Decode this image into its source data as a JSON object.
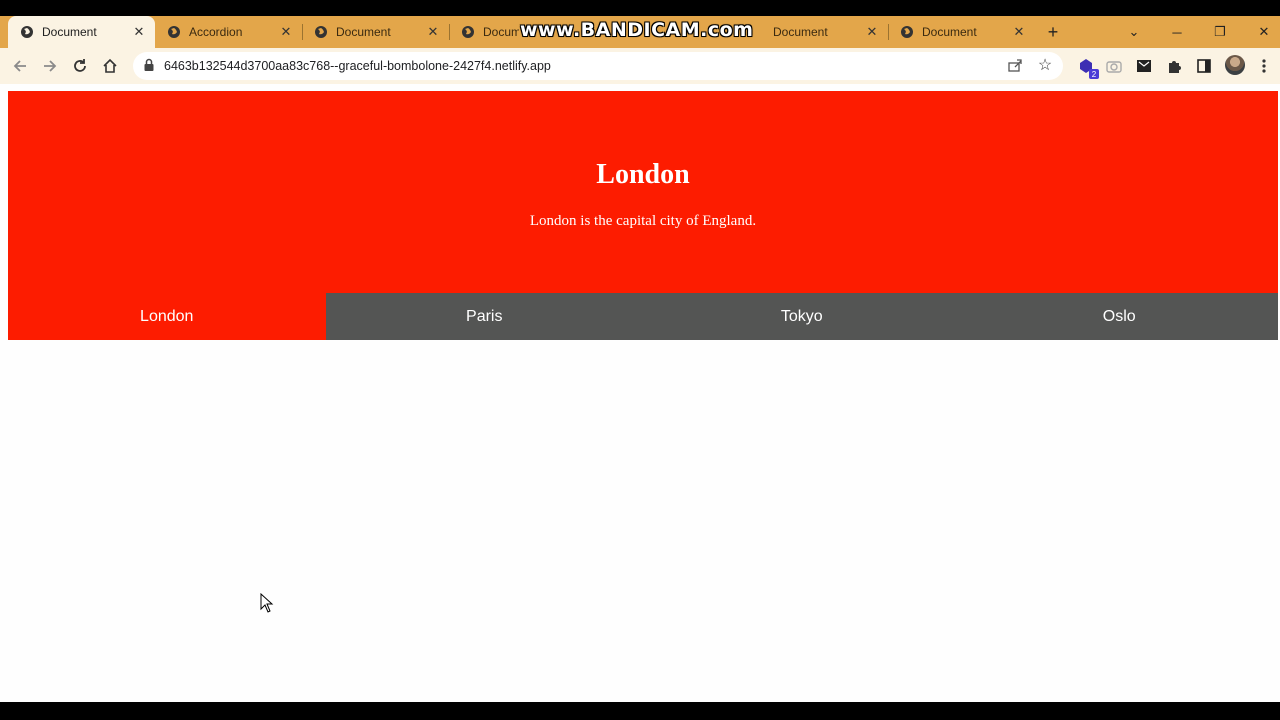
{
  "browser": {
    "tabs": [
      {
        "title": "Document",
        "active": true
      },
      {
        "title": "Accordion",
        "active": false
      },
      {
        "title": "Document",
        "active": false
      },
      {
        "title": "Document",
        "active": false
      },
      {
        "title": "Document",
        "active": false
      },
      {
        "title": "Document",
        "active": false
      }
    ],
    "new_tab": "+",
    "url": "6463b132544d3700aa83c768--graceful-bombolone-2427f4.netlify.app",
    "extension_badge": "2"
  },
  "watermark": "www.BANDICAM.com",
  "content": {
    "panel": {
      "title": "London",
      "text": "London is the capital city of England.",
      "color": "#fd1c00"
    },
    "city_tabs": [
      {
        "label": "London",
        "active": true
      },
      {
        "label": "Paris",
        "active": false
      },
      {
        "label": "Tokyo",
        "active": false
      },
      {
        "label": "Oslo",
        "active": false
      }
    ],
    "tab_bar_color": "#545554"
  }
}
